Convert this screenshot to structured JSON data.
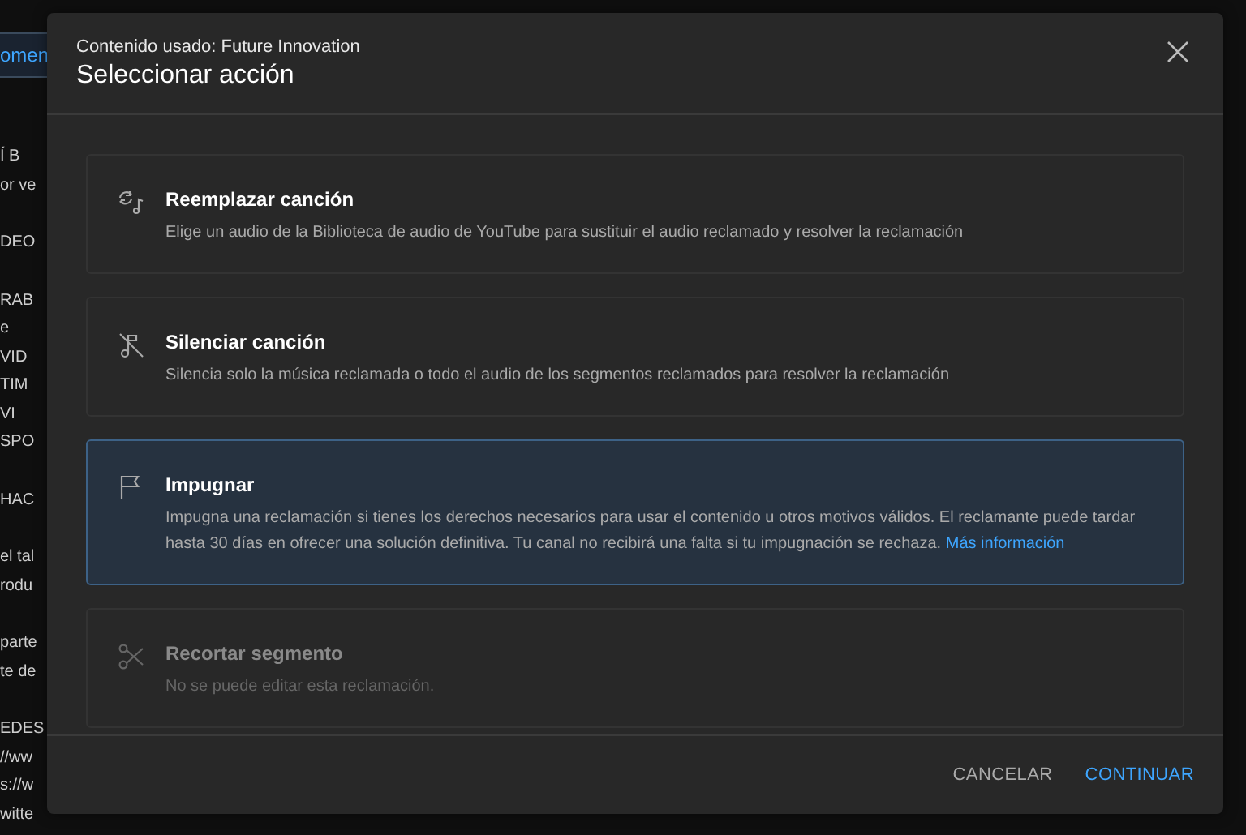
{
  "background": {
    "tab": "omen",
    "paragraphs": [
      [
        "Í B",
        "or ve"
      ],
      [
        "DEO"
      ],
      [
        "RAB",
        "e",
        "VID",
        "TIM",
        "VI",
        "SPO"
      ],
      [
        "HAC"
      ],
      [
        "el tal",
        "rodu"
      ],
      [
        "parte",
        "te de"
      ],
      [
        "EDES",
        "//ww",
        "s://w",
        "witte"
      ]
    ]
  },
  "dialog": {
    "subtitle": "Contenido usado: Future Innovation",
    "title": "Seleccionar acción",
    "options": [
      {
        "kind": "replace",
        "title": "Reemplazar canción",
        "description": "Elige un audio de la Biblioteca de audio de YouTube para sustituir el audio reclamado y resolver la reclamación",
        "selected": false,
        "disabled": false
      },
      {
        "kind": "mute",
        "title": "Silenciar canción",
        "description": "Silencia solo la música reclamada o todo el audio de los segmentos reclamados para resolver la reclamación",
        "selected": false,
        "disabled": false
      },
      {
        "kind": "dispute",
        "title": "Impugnar",
        "description": "Impugna una reclamación si tienes los derechos necesarios para usar el contenido u otros motivos válidos. El reclamante puede tardar hasta 30 días en ofrecer una solución definitiva. Tu canal no recibirá una falta si tu impugnación se rechaza.",
        "link": "Más información",
        "selected": true,
        "disabled": false
      },
      {
        "kind": "trim",
        "title": "Recortar segmento",
        "description": "No se puede editar esta reclamación.",
        "selected": false,
        "disabled": true
      }
    ],
    "buttons": [
      {
        "label": "CANCELAR",
        "primary": false
      },
      {
        "label": "CONTINUAR",
        "primary": true
      }
    ]
  }
}
